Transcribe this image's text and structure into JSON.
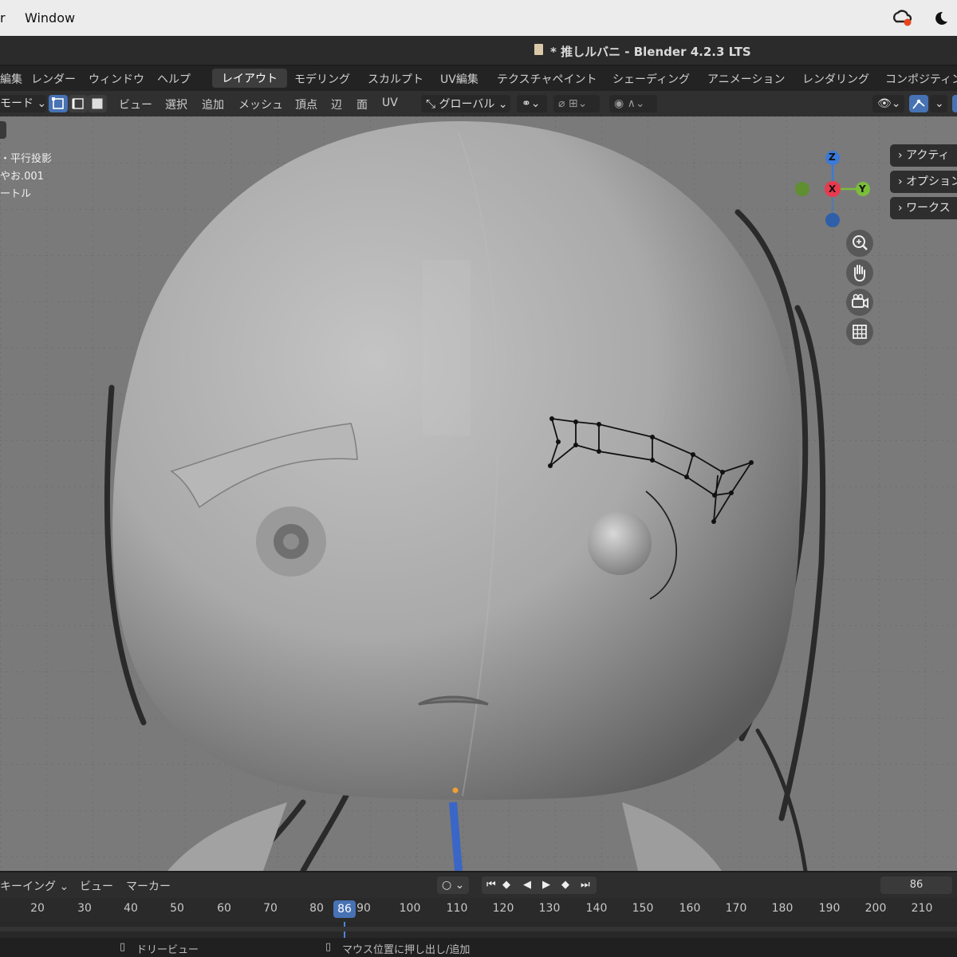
{
  "menubar": {
    "app_fragment": "r",
    "window_menu": "Window"
  },
  "titlebar": {
    "title": "* 推しルバニ - Blender 4.2.3 LTS"
  },
  "menus": {
    "edit": "編集",
    "render": "レンダー",
    "window": "ウィンドウ",
    "help": "ヘルプ"
  },
  "workspaces": {
    "active": "レイアウト",
    "tabs": [
      "モデリング",
      "スカルプト",
      "UV編集",
      "テクスチャペイント",
      "シェーディング",
      "アニメーション",
      "レンダリング",
      "コンポジティン"
    ]
  },
  "toolbar": {
    "mode": "モード",
    "view": "ビュー",
    "select": "選択",
    "add": "追加",
    "mesh": "メッシュ",
    "vertex": "頂点",
    "edge": "辺",
    "face": "面",
    "uv": "UV",
    "transform_orientation": "グローバル"
  },
  "viewport": {
    "info_lines": [
      "・平行投影",
      "やお.001",
      "ートル"
    ],
    "gizmo": {
      "z": "Z",
      "x": "X",
      "y": "Y"
    },
    "npanel": [
      "アクティ",
      "オプション",
      "ワークス"
    ],
    "colors": {
      "background": "#7a7a7a",
      "x_axis": "#e83a4f",
      "y_axis": "#7bbd3a",
      "z_axis": "#3a7ad8"
    }
  },
  "timeline": {
    "keying": "キーイング",
    "view": "ビュー",
    "marker": "マーカー",
    "current_frame": "86",
    "frame_field": "86",
    "ticks": [
      "20",
      "30",
      "40",
      "50",
      "60",
      "70",
      "80",
      "90",
      "100",
      "110",
      "120",
      "130",
      "140",
      "150",
      "160",
      "170",
      "180",
      "190",
      "200",
      "210"
    ]
  },
  "statusbar": {
    "left_hint": "ドリービュー",
    "right_hint": "マウス位置に押し出し/追加"
  }
}
